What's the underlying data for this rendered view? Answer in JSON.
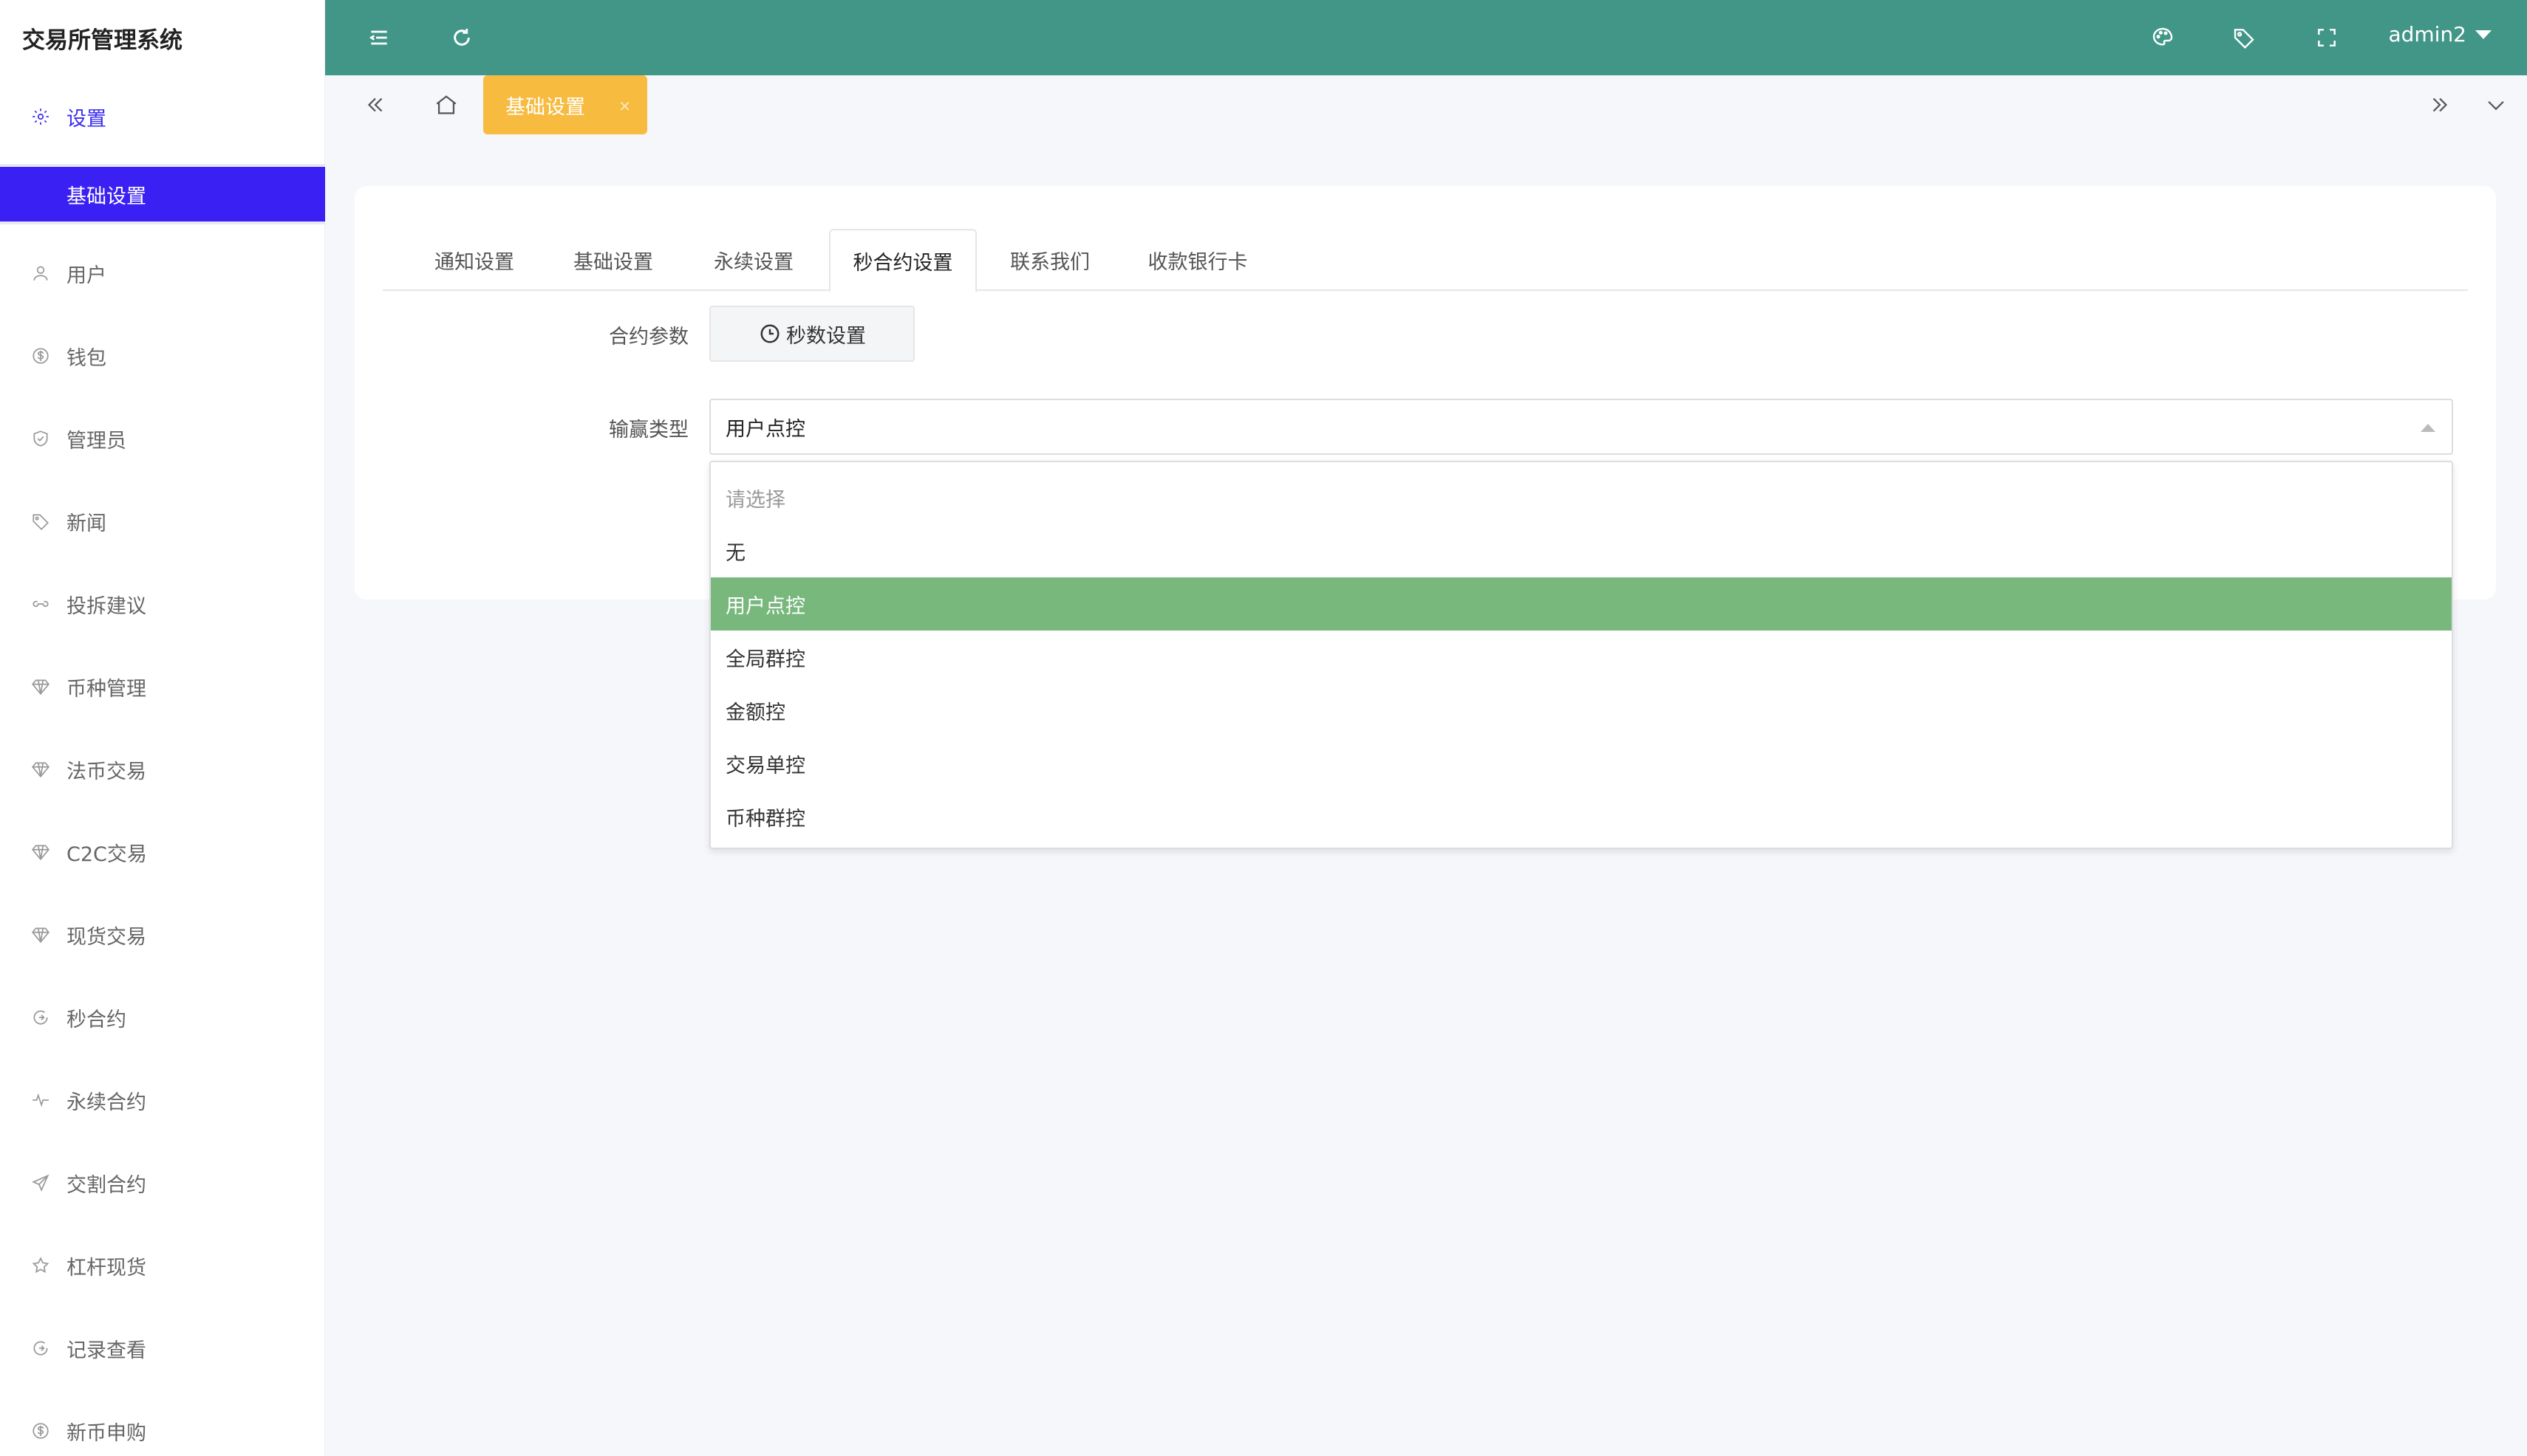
{
  "app": {
    "title": "交易所管理系统"
  },
  "sidebar": {
    "parent": {
      "label": "设置",
      "icon": "gear-icon"
    },
    "sub_active": {
      "label": "基础设置"
    },
    "items": [
      {
        "label": "用户",
        "icon": "user-icon"
      },
      {
        "label": "钱包",
        "icon": "dollar-icon"
      },
      {
        "label": "管理员",
        "icon": "shield-icon"
      },
      {
        "label": "新闻",
        "icon": "tag-icon"
      },
      {
        "label": "投拆建议",
        "icon": "link-icon"
      },
      {
        "label": "币种管理",
        "icon": "diamond-icon"
      },
      {
        "label": "法币交易",
        "icon": "diamond-icon"
      },
      {
        "label": "C2C交易",
        "icon": "diamond-icon"
      },
      {
        "label": "现货交易",
        "icon": "diamond-icon"
      },
      {
        "label": "秒合约",
        "icon": "circle-arrow-icon"
      },
      {
        "label": "永续合约",
        "icon": "pulse-icon"
      },
      {
        "label": "交割合约",
        "icon": "send-icon"
      },
      {
        "label": "杠杆现货",
        "icon": "star-icon"
      },
      {
        "label": "记录查看",
        "icon": "circle-arrow-icon"
      },
      {
        "label": "新币申购",
        "icon": "dollar-icon"
      }
    ]
  },
  "topbar": {
    "icons": [
      "menu-icon",
      "refresh-icon",
      "palette-icon",
      "tag-icon",
      "fullscreen-icon"
    ],
    "user": "admin2"
  },
  "tabsbar": {
    "page_tab": "基础设置"
  },
  "settings": {
    "tabs": [
      {
        "label": "通知设置"
      },
      {
        "label": "基础设置"
      },
      {
        "label": "永续设置"
      },
      {
        "label": "秒合约设置",
        "active": true
      },
      {
        "label": "联系我们"
      },
      {
        "label": "收款银行卡"
      }
    ],
    "contract_params_label": "合约参数",
    "seconds_button": "秒数设置",
    "win_type_label": "输赢类型",
    "win_type_value": "用户点控",
    "options": [
      {
        "label": "请选择",
        "placeholder": true
      },
      {
        "label": "无"
      },
      {
        "label": "用户点控",
        "selected": true
      },
      {
        "label": "全局群控"
      },
      {
        "label": "金额控"
      },
      {
        "label": "交易单控"
      },
      {
        "label": "币种群控"
      }
    ]
  },
  "colors": {
    "topbar": "#429688",
    "sidebar_active": "#3a20f2",
    "page_tab": "#f6bb3f",
    "option_selected": "#78b87d"
  }
}
